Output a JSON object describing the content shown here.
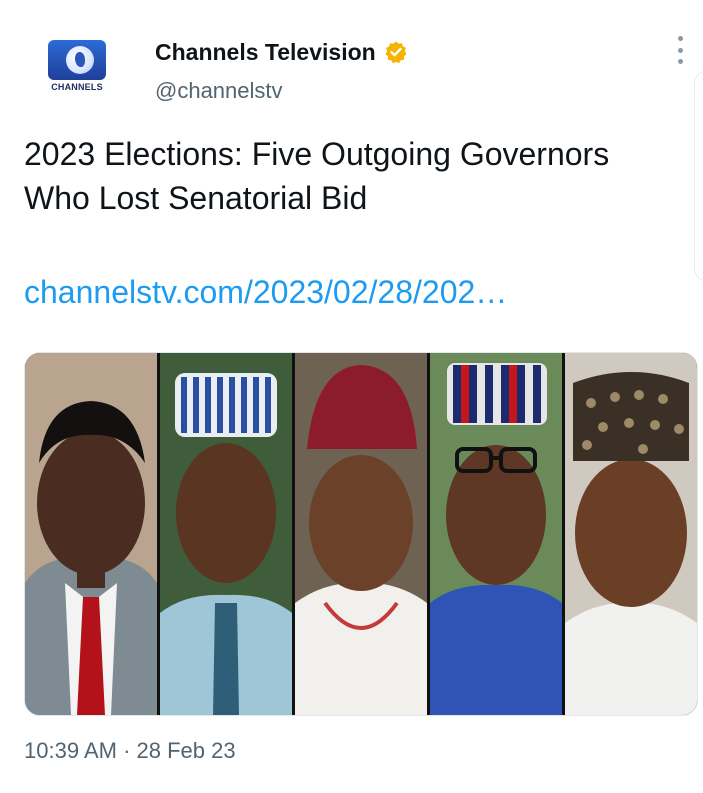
{
  "account": {
    "avatar_text": "CHANNELS",
    "display_name": "Channels Television",
    "verified_icon": "verified-badge-icon",
    "verified_color": "#f4b400",
    "handle": "@channelstv"
  },
  "tweet": {
    "text": "2023 Elections: Five Outgoing Governors Who Lost Senatorial Bid",
    "link": "channelstv.com/2023/02/28/202…",
    "link_color": "#1d9bf0",
    "media_icon": "photo-collage-five-governors",
    "timestamp": "10:39 AM · 28 Feb 23"
  },
  "menu": {
    "more_icon": "more-vertical-icon"
  }
}
